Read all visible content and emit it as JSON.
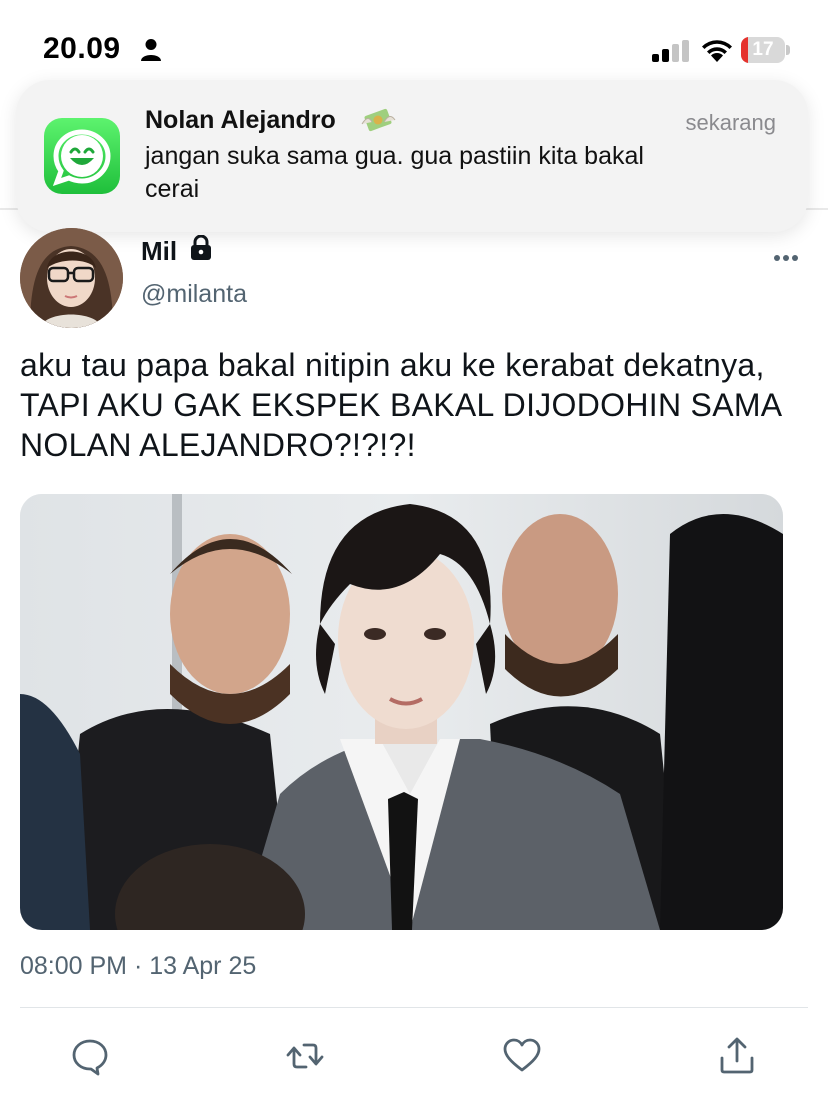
{
  "status_bar": {
    "time": "20.09",
    "battery_level": "17",
    "battery_fraction": 0.17,
    "battery_color": "#e5322d"
  },
  "notification": {
    "app_icon": "whatsapp-style-green-chat-icon",
    "title": "Nolan Alejandro",
    "title_emoji": "money-with-wings-emoji",
    "time": "sekarang",
    "body": "jangan suka sama gua. gua pastiin kita bakal cerai"
  },
  "tweet": {
    "display_name": "Mil",
    "name_badge": "lock-icon",
    "username": "@milanta",
    "text": "aku tau papa bakal nitipin aku ke kerabat dekatnya, TAPI AKU GAK EKSPEK BAKAL DIJODOHIN SAMA NOLAN ALEJANDRO?!?!?!",
    "timestamp": "08:00 PM · 13 Apr 25",
    "actions": [
      "reply-icon",
      "retweet-icon",
      "like-icon",
      "share-icon"
    ]
  },
  "colors": {
    "accent_text": "#0f1419",
    "secondary_text": "#536471",
    "notification_bg": "#f3f3f3"
  }
}
